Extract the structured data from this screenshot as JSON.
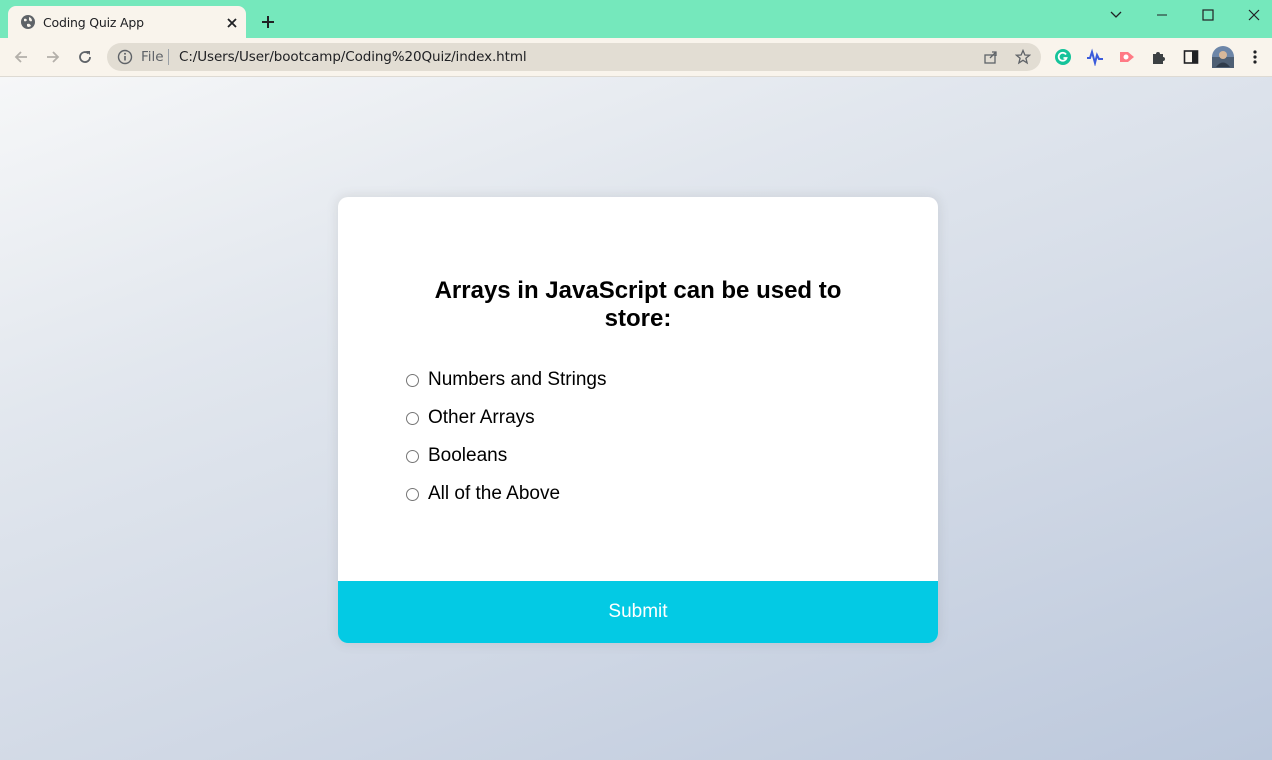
{
  "browser": {
    "tab_title": "Coding Quiz App",
    "address_scheme_label": "File",
    "address_url": "C:/Users/User/bootcamp/Coding%20Quiz/index.html",
    "accent_color": "#75e8bc",
    "icons": {
      "favicon": "globe-icon",
      "tab_close": "close-icon",
      "new_tab": "plus-icon",
      "back": "arrow-left-icon",
      "forward": "arrow-right-icon",
      "reload": "reload-icon",
      "site_info": "info-icon",
      "share": "share-icon",
      "bookmark": "star-icon",
      "extensions": [
        "grammarly-icon",
        "wave-icon",
        "screen-recorder-icon",
        "puzzle-icon"
      ],
      "side_panel": "side-panel-icon",
      "profile": "avatar",
      "menu": "kebab-menu-icon",
      "tab_search": "chevron-down-icon",
      "minimize": "minimize-icon",
      "maximize": "maximize-icon",
      "close_window": "close-icon"
    }
  },
  "quiz": {
    "question": "Arrays in JavaScript can be used to store:",
    "answers": [
      {
        "label": "Numbers and Strings",
        "selected": false
      },
      {
        "label": "Other Arrays",
        "selected": false
      },
      {
        "label": "Booleans",
        "selected": false
      },
      {
        "label": "All of the Above",
        "selected": false
      }
    ],
    "submit_label": "Submit",
    "submit_color": "#03cae4"
  }
}
